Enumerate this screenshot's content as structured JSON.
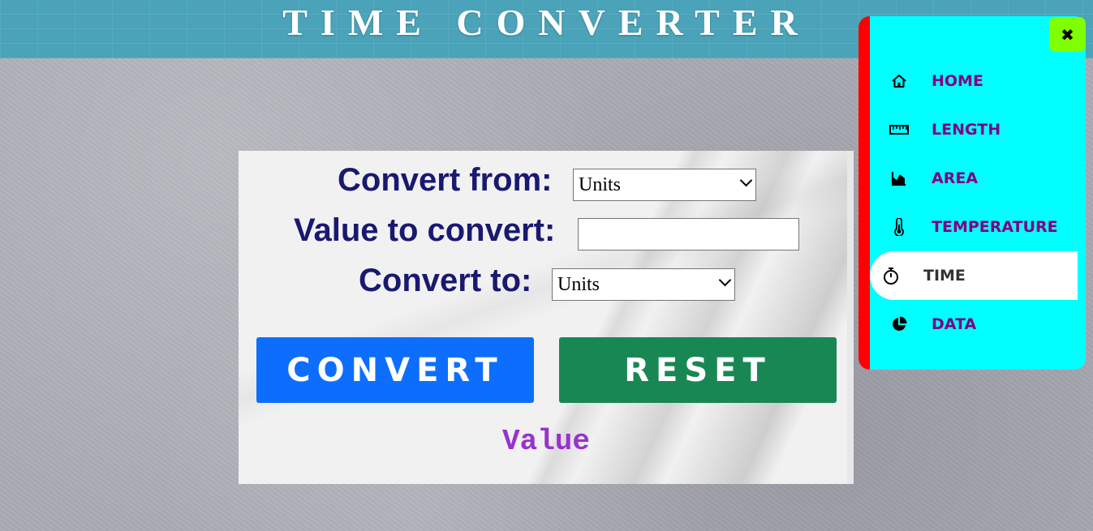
{
  "header": {
    "title": "TIME CONVERTER"
  },
  "form": {
    "from_label": "Convert from:",
    "from_select": "Units",
    "value_label": "Value to convert:",
    "value_input": "",
    "to_label": "Convert to:",
    "to_select": "Units",
    "convert_button": "CONVERT",
    "reset_button": "RESET",
    "result": "Value"
  },
  "nav": {
    "close_label": "✖",
    "items": [
      {
        "label": "HOME",
        "icon": "home-icon"
      },
      {
        "label": "LENGTH",
        "icon": "ruler-icon"
      },
      {
        "label": "AREA",
        "icon": "area-chart-icon"
      },
      {
        "label": "TEMPERATURE",
        "icon": "thermometer-icon"
      },
      {
        "label": "TIME",
        "icon": "stopwatch-icon",
        "active": true
      },
      {
        "label": "DATA",
        "icon": "pie-chart-icon"
      }
    ]
  },
  "colors": {
    "header_bg": "#4aa3b8",
    "label_text": "#191970",
    "convert_button": "#0d6efd",
    "reset_button": "#198754",
    "result_text": "#9932cc",
    "nav_bg": "#00ffff",
    "nav_border": "#ff0000",
    "nav_text": "#800080",
    "close_bg": "#7fff00"
  }
}
